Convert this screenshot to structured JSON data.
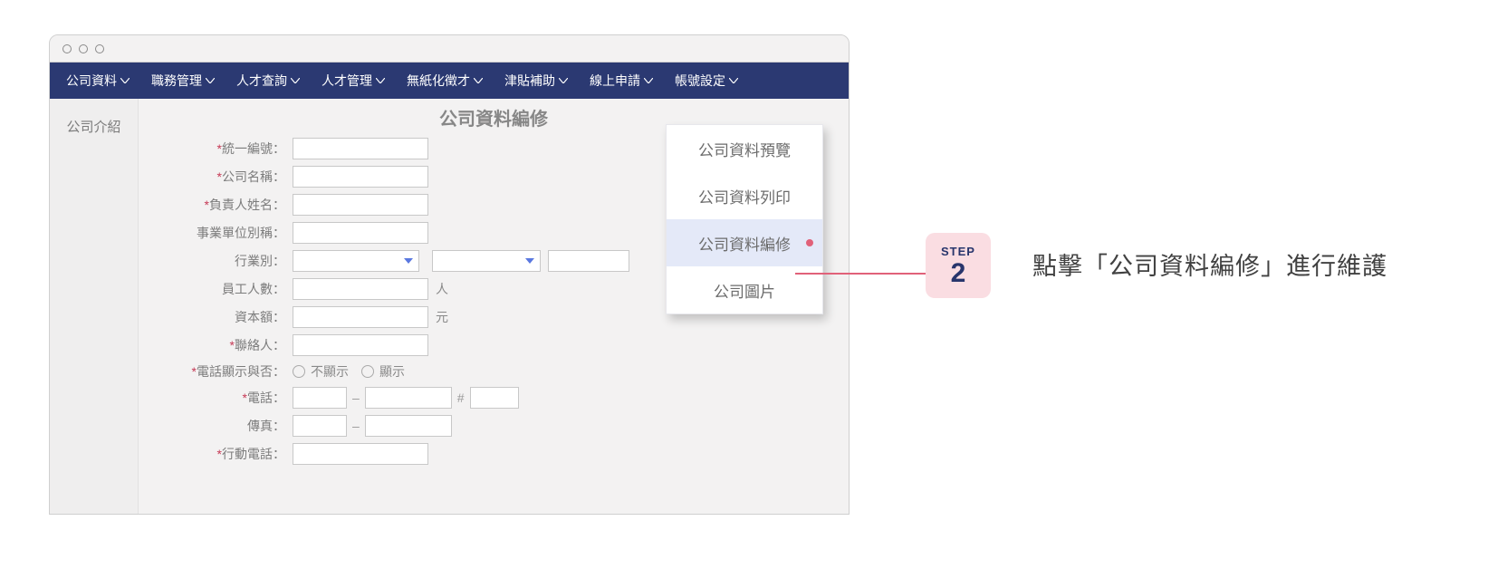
{
  "nav": {
    "items": [
      {
        "label": "公司資料"
      },
      {
        "label": "職務管理"
      },
      {
        "label": "人才查詢"
      },
      {
        "label": "人才管理"
      },
      {
        "label": "無紙化徵才"
      },
      {
        "label": "津貼補助"
      },
      {
        "label": "線上申請"
      },
      {
        "label": "帳號設定"
      }
    ]
  },
  "sidebar": {
    "tab0": "公司介紹"
  },
  "page_title": "公司資料編修",
  "form": {
    "unified_no": {
      "label": "統一編號：",
      "required": true
    },
    "company_name": {
      "label": "公司名稱：",
      "required": true
    },
    "owner_name": {
      "label": "負責人姓名：",
      "required": true
    },
    "unit_alias": {
      "label": "事業單位別稱：",
      "required": false
    },
    "industry": {
      "label": "行業別：",
      "required": false
    },
    "employees": {
      "label": "員工人數：",
      "required": false,
      "unit": "人"
    },
    "capital": {
      "label": "資本額：",
      "required": false,
      "unit": "元"
    },
    "contact": {
      "label": "聯絡人：",
      "required": true
    },
    "phone_visible": {
      "label": "電話顯示與否：",
      "required": true,
      "opt_hide": "不顯示",
      "opt_show": "顯示"
    },
    "phone": {
      "label": "電話：",
      "required": true,
      "sep": "–",
      "ext_sep": "#"
    },
    "fax": {
      "label": "傳真：",
      "required": false,
      "sep": "–"
    },
    "mobile": {
      "label": "行動電話：",
      "required": true
    }
  },
  "dropdown": {
    "items": [
      {
        "label": "公司資料預覽"
      },
      {
        "label": "公司資料列印"
      },
      {
        "label": "公司資料編修",
        "active": true
      },
      {
        "label": "公司圖片"
      }
    ]
  },
  "step": {
    "label": "STEP",
    "num": "2"
  },
  "instruction": "點擊「公司資料編修」進行維護"
}
